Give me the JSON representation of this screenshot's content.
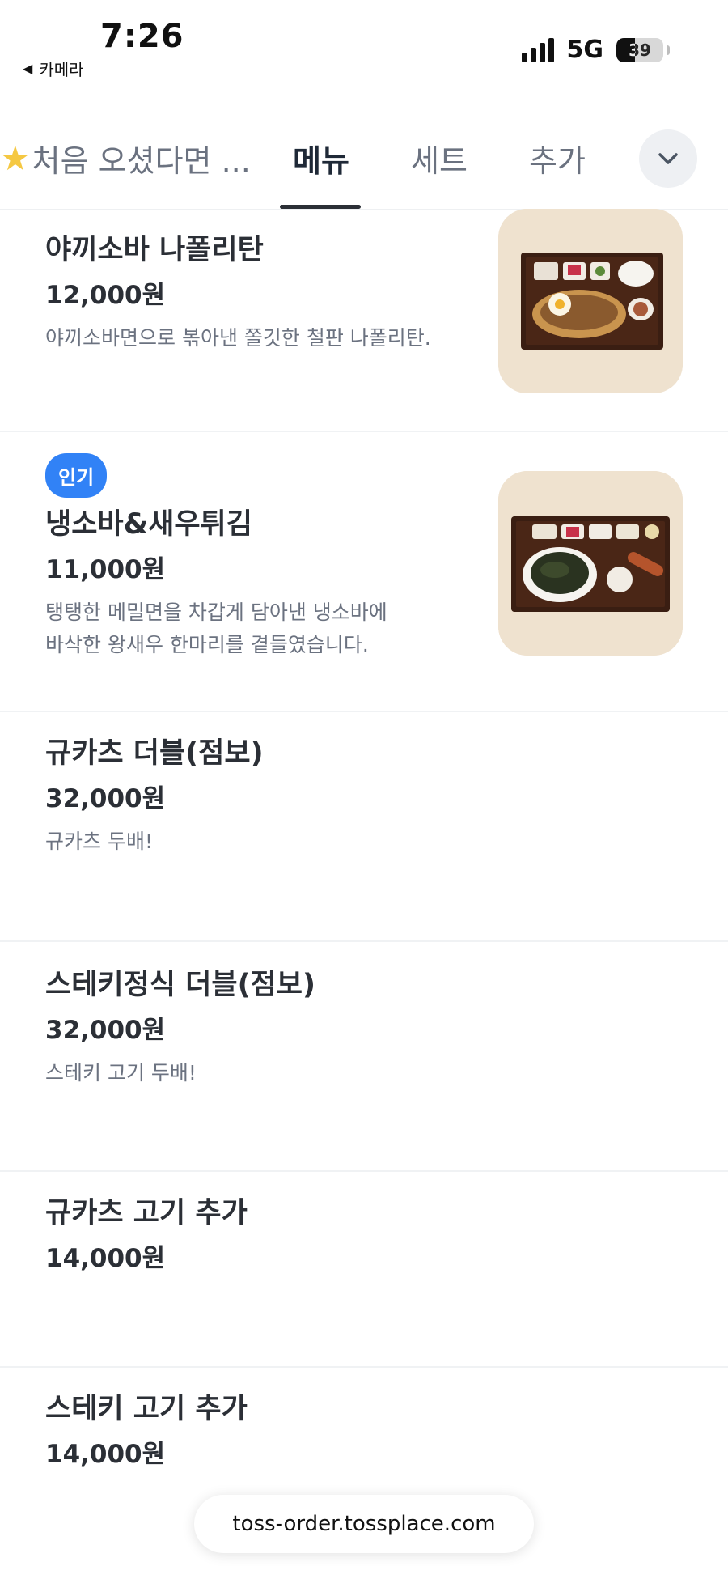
{
  "status_bar": {
    "time": "7:26",
    "back_label": "카메라",
    "back_icon": "triangle-left-icon",
    "network": "5G",
    "battery_level": 39
  },
  "tabs": [
    {
      "label": "처음 오셨다면 ...",
      "icon": "star-icon",
      "active": false
    },
    {
      "label": "메뉴",
      "active": true
    },
    {
      "label": "세트",
      "active": false
    },
    {
      "label": "추가",
      "active": false
    }
  ],
  "expand_icon": "chevron-down-icon",
  "menu_items": [
    {
      "name": "야끼소바 나폴리탄",
      "price": "12,000원",
      "description": [
        "야끼소바면으로 볶아낸 쫄깃한 철판 나폴리탄."
      ],
      "has_image": true,
      "image_subject": "napolitan-set-photo"
    },
    {
      "badge": "인기",
      "name": "냉소바&새우튀김",
      "price": "11,000원",
      "description": [
        "탱탱한 메밀면을 차갑게 담아낸 냉소바에",
        "바삭한 왕새우 한마리를 곁들였습니다."
      ],
      "has_image": true,
      "image_subject": "cold-soba-set-photo"
    },
    {
      "name": "규카츠 더블(점보)",
      "price": "32,000원",
      "description": [
        "규카츠 두배!"
      ]
    },
    {
      "name": "스테키정식 더블(점보)",
      "price": "32,000원",
      "description": [
        "스테키 고기 두배!"
      ]
    },
    {
      "name": "규카츠 고기 추가",
      "price": "14,000원"
    },
    {
      "name": "스테키 고기 추가",
      "price": "14,000원"
    }
  ],
  "url_bar": {
    "url": "toss-order.tossplace.com"
  },
  "colors": {
    "badge": "#3182f6",
    "active_tab": "#1f2937",
    "inactive_tab": "#6b7280",
    "thumb_bg": "#efe2cf"
  }
}
